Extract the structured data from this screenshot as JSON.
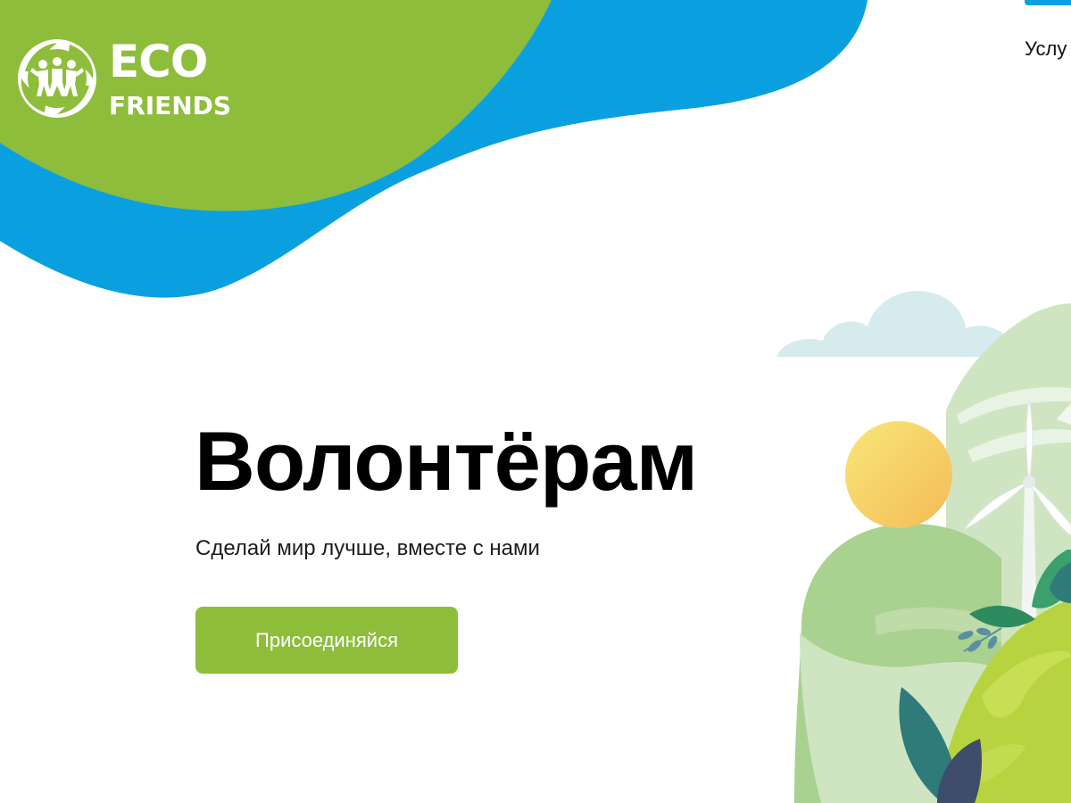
{
  "header": {
    "logo": {
      "line1": "ECO",
      "line2": "FRIENDS",
      "icon": "eco-friends-leaf-wreath-icon"
    },
    "nav": {
      "services_label": "Услу"
    }
  },
  "hero": {
    "title": "Волонтёрам",
    "subtitle": "Сделай мир лучше, вместе с нами",
    "cta_label": "Присоединяйся"
  },
  "colors": {
    "brand_green": "#8dbd3b",
    "brand_blue": "#0aa0e0",
    "cloud": "#d5ebee",
    "sun": "#f6c85a",
    "hill_light": "#cfe5c2",
    "hill_mid": "#a9d18f",
    "planet": "#b7d440",
    "leaf_dark": "#2e7b7a",
    "leaf_navy": "#3d4d6a"
  }
}
